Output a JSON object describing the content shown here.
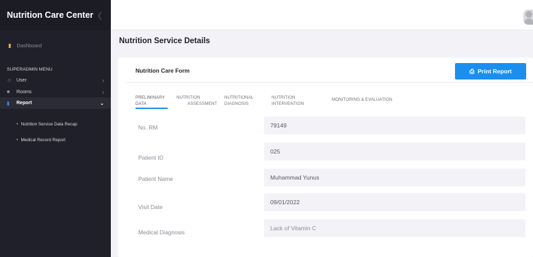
{
  "app": {
    "title": "Nutrition Care Center"
  },
  "sidebar": {
    "dashboard": "Dashboard",
    "menu_title": "SUPERADMIN MENU",
    "items": [
      {
        "label": "User",
        "icon": "users-icon"
      },
      {
        "label": "Rooms",
        "icon": "building-icon"
      },
      {
        "label": "Report",
        "icon": "document-icon",
        "active": true
      }
    ],
    "sub_items": [
      {
        "label": "Nutrition Service Data Recap"
      },
      {
        "label": "Medical Record Report"
      }
    ]
  },
  "page": {
    "title": "Nutrition Service Details"
  },
  "form": {
    "title": "Nutrition Care Form",
    "print_label": "Print Report",
    "tabs": [
      {
        "line1": "PRELIMINARY",
        "line2": "DATA",
        "active": true
      },
      {
        "line1": "NUTRITION",
        "line2": "ASSESSMENT"
      },
      {
        "line1": "NUTRITIONAL",
        "line2": "DIAGNOSIS"
      },
      {
        "line1": "NUTRITION",
        "line2": "INTERVENTION"
      },
      {
        "line1": "MONITORING & EVALUATION",
        "line2": ""
      }
    ],
    "fields": [
      {
        "label": "No. RM",
        "value": "79149"
      },
      {
        "label": "Patient ID",
        "value": "025"
      },
      {
        "label": "Patient Name",
        "value": "Muhammad Yunus"
      },
      {
        "label": "Visit Date",
        "value": "09/01/2022"
      },
      {
        "label": "Medical Diagnosis",
        "value": "Lack of Vitamin C"
      }
    ]
  },
  "colors": {
    "sidebar_bg": "#1f2029",
    "accent_blue": "#1b8ff0",
    "dashboard_icon": "#e3b04b",
    "content_bg": "#f3f3f7"
  }
}
